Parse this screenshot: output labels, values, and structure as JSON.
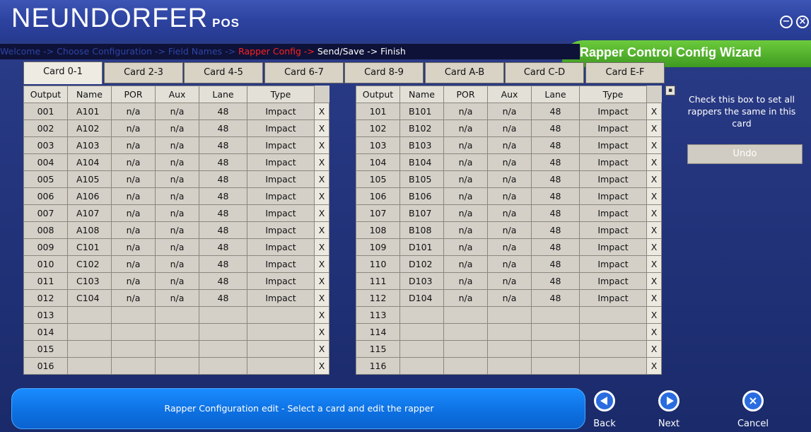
{
  "app": {
    "brand": "NEUNDORFER",
    "brand_sub": "POS",
    "minimize_glyph": "−",
    "close_glyph": "×"
  },
  "breadcrumb": {
    "past": "Welcome -> Choose Configuration -> Field Names -> ",
    "current": "Rapper Config -> ",
    "next": "Send/Save -> Finish"
  },
  "wizard_title": "Rapper Control Config Wizard",
  "card_tabs": [
    "Card 0-1",
    "Card 2-3",
    "Card 4-5",
    "Card 6-7",
    "Card 8-9",
    "Card A-B",
    "Card C-D",
    "Card E-F"
  ],
  "active_card_index": 0,
  "columns": [
    "Output",
    "Name",
    "POR",
    "Aux",
    "Lane",
    "Type"
  ],
  "delete_glyph": "X",
  "left_grid": [
    [
      "001",
      "A101",
      "n/a",
      "n/a",
      "48",
      "Impact"
    ],
    [
      "002",
      "A102",
      "n/a",
      "n/a",
      "48",
      "Impact"
    ],
    [
      "003",
      "A103",
      "n/a",
      "n/a",
      "48",
      "Impact"
    ],
    [
      "004",
      "A104",
      "n/a",
      "n/a",
      "48",
      "Impact"
    ],
    [
      "005",
      "A105",
      "n/a",
      "n/a",
      "48",
      "Impact"
    ],
    [
      "006",
      "A106",
      "n/a",
      "n/a",
      "48",
      "Impact"
    ],
    [
      "007",
      "A107",
      "n/a",
      "n/a",
      "48",
      "Impact"
    ],
    [
      "008",
      "A108",
      "n/a",
      "n/a",
      "48",
      "Impact"
    ],
    [
      "009",
      "C101",
      "n/a",
      "n/a",
      "48",
      "Impact"
    ],
    [
      "010",
      "C102",
      "n/a",
      "n/a",
      "48",
      "Impact"
    ],
    [
      "011",
      "C103",
      "n/a",
      "n/a",
      "48",
      "Impact"
    ],
    [
      "012",
      "C104",
      "n/a",
      "n/a",
      "48",
      "Impact"
    ],
    [
      "013",
      "",
      "",
      "",
      "",
      ""
    ],
    [
      "014",
      "",
      "",
      "",
      "",
      ""
    ],
    [
      "015",
      "",
      "",
      "",
      "",
      ""
    ],
    [
      "016",
      "",
      "",
      "",
      "",
      ""
    ]
  ],
  "right_grid": [
    [
      "101",
      "B101",
      "n/a",
      "n/a",
      "48",
      "Impact"
    ],
    [
      "102",
      "B102",
      "n/a",
      "n/a",
      "48",
      "Impact"
    ],
    [
      "103",
      "B103",
      "n/a",
      "n/a",
      "48",
      "Impact"
    ],
    [
      "104",
      "B104",
      "n/a",
      "n/a",
      "48",
      "Impact"
    ],
    [
      "105",
      "B105",
      "n/a",
      "n/a",
      "48",
      "Impact"
    ],
    [
      "106",
      "B106",
      "n/a",
      "n/a",
      "48",
      "Impact"
    ],
    [
      "107",
      "B107",
      "n/a",
      "n/a",
      "48",
      "Impact"
    ],
    [
      "108",
      "B108",
      "n/a",
      "n/a",
      "48",
      "Impact"
    ],
    [
      "109",
      "D101",
      "n/a",
      "n/a",
      "48",
      "Impact"
    ],
    [
      "110",
      "D102",
      "n/a",
      "n/a",
      "48",
      "Impact"
    ],
    [
      "111",
      "D103",
      "n/a",
      "n/a",
      "48",
      "Impact"
    ],
    [
      "112",
      "D104",
      "n/a",
      "n/a",
      "48",
      "Impact"
    ],
    [
      "113",
      "",
      "",
      "",
      "",
      ""
    ],
    [
      "114",
      "",
      "",
      "",
      "",
      ""
    ],
    [
      "115",
      "",
      "",
      "",
      "",
      ""
    ],
    [
      "116",
      "",
      "",
      "",
      "",
      ""
    ]
  ],
  "help_text": "Check this box to set all rappers the same in this card",
  "undo_label": "Undo",
  "status_text": "Rapper Configuration edit - Select a card and edit the rapper",
  "nav": {
    "back_label": "Back",
    "next_label": "Next",
    "cancel_label": "Cancel"
  },
  "icons": {
    "minimize": "minimize-icon",
    "close": "close-icon",
    "back": "back-arrow-icon",
    "next": "next-arrow-icon",
    "cancel": "cancel-x-icon"
  }
}
